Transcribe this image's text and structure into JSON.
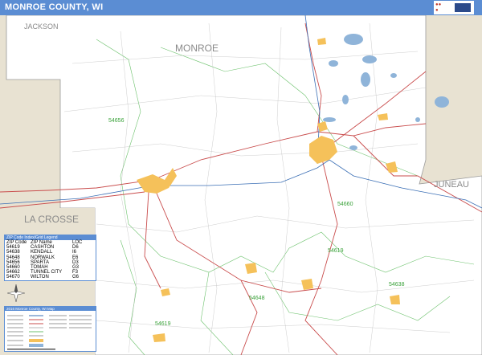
{
  "header": {
    "title": "MONROE COUNTY, WI"
  },
  "map": {
    "colors": {
      "land": "#ffffff",
      "outside": "#e8e2d2",
      "water": "#8fb4d9",
      "urban": "#f5c15a",
      "highway": "#c94c4c",
      "interstate": "#3b6fb5",
      "zip_boundary": "#6dc26d",
      "county_border": "#9a9a9a"
    },
    "region_labels": {
      "jackson": "JACKSON",
      "monroe": "MONROE",
      "juneau": "JUNEAU",
      "la_crosse": "LA CROSSE"
    },
    "zip_labels": {
      "z1": "54656",
      "z2": "54660",
      "z3": "54619",
      "z4": "54638",
      "z5": "54648",
      "z6": "54619"
    }
  },
  "legend": {
    "header": "ZIP Code Index/Grid Legend",
    "columns": [
      "ZIP Code",
      "ZIP Name",
      "LOC"
    ],
    "rows": [
      [
        "54619",
        "CASHTON",
        "D6"
      ],
      [
        "54638",
        "KENDALL",
        "I6"
      ],
      [
        "54648",
        "NORWALK",
        "E6"
      ],
      [
        "54656",
        "SPARTA",
        "D3"
      ],
      [
        "54660",
        "TOMAH",
        "G3"
      ],
      [
        "54662",
        "TUNNEL CITY",
        "F3"
      ],
      [
        "54670",
        "WILTON",
        "G6"
      ]
    ]
  },
  "key": {
    "header": "2016 Monroe County, WI Map"
  }
}
